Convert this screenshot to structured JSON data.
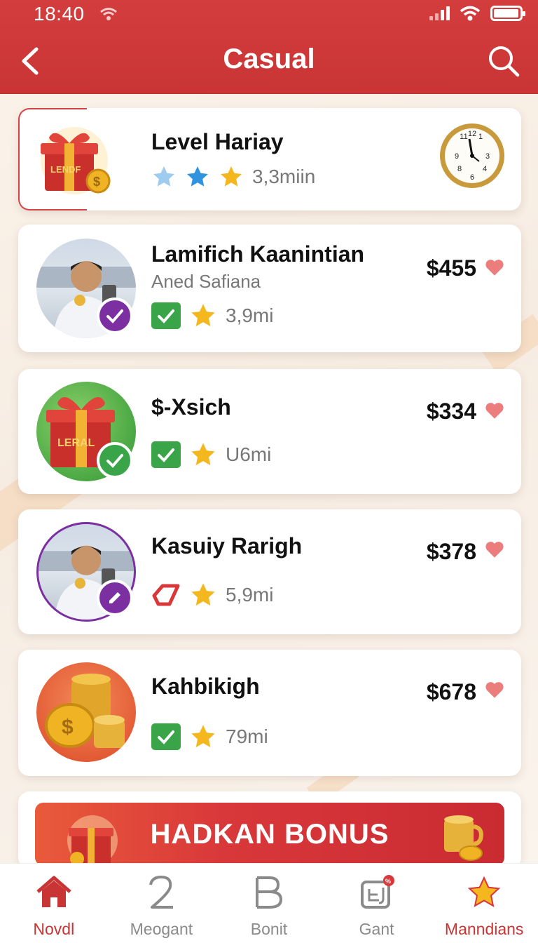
{
  "status_bar": {
    "time": "18:40"
  },
  "header": {
    "title": "Casual"
  },
  "featured": {
    "title": "Level Hariay",
    "duration": "3,3miin"
  },
  "items": [
    {
      "title": "Lamifich Kaanintian",
      "subtitle": "Aned Safiana",
      "duration": "3,9mi",
      "price": "$455"
    },
    {
      "title": "$-Xsich",
      "duration": "U6mi",
      "price": "$334"
    },
    {
      "title": "Kasuiy Rarigh",
      "duration": "5,9mi",
      "price": "$378"
    },
    {
      "title": "Kahbikigh",
      "duration": "79mi",
      "price": "$678"
    }
  ],
  "bonus": {
    "label": "HADKAN BONUS",
    "gift_text": "LENDF",
    "gift2_text": "LERAL"
  },
  "tabs": [
    {
      "label": "Novdl"
    },
    {
      "label": "Meogant"
    },
    {
      "label": "Bonit"
    },
    {
      "label": "Gant"
    },
    {
      "label": "Manndians"
    }
  ],
  "colors": {
    "accent": "#c93434",
    "check": "#3aa548",
    "badge_purple": "#7b2fa0",
    "star": "#f4b81e"
  }
}
